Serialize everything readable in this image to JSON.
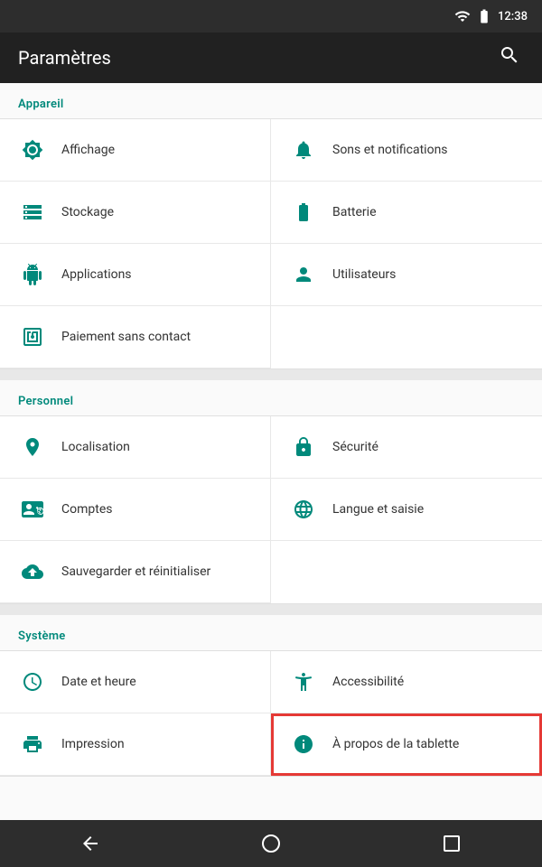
{
  "statusBar": {
    "time": "12:38"
  },
  "topBar": {
    "title": "Paramètres",
    "searchLabel": "Rechercher"
  },
  "sections": [
    {
      "id": "appareil",
      "header": "Appareil",
      "items": [
        {
          "id": "affichage",
          "label": "Affichage",
          "icon": "display",
          "fullWidth": false
        },
        {
          "id": "sons-notifications",
          "label": "Sons et notifications",
          "icon": "bell",
          "fullWidth": false
        },
        {
          "id": "stockage",
          "label": "Stockage",
          "icon": "storage",
          "fullWidth": false
        },
        {
          "id": "batterie",
          "label": "Batterie",
          "icon": "battery",
          "fullWidth": false
        },
        {
          "id": "applications",
          "label": "Applications",
          "icon": "android",
          "fullWidth": false
        },
        {
          "id": "utilisateurs",
          "label": "Utilisateurs",
          "icon": "person",
          "fullWidth": false
        },
        {
          "id": "paiement",
          "label": "Paiement sans contact",
          "icon": "nfc",
          "fullWidth": true
        }
      ]
    },
    {
      "id": "personnel",
      "header": "Personnel",
      "items": [
        {
          "id": "localisation",
          "label": "Localisation",
          "icon": "location",
          "fullWidth": false
        },
        {
          "id": "securite",
          "label": "Sécurité",
          "icon": "lock",
          "fullWidth": false
        },
        {
          "id": "comptes",
          "label": "Comptes",
          "icon": "contacts",
          "fullWidth": false
        },
        {
          "id": "langue",
          "label": "Langue et saisie",
          "icon": "globe",
          "fullWidth": false
        },
        {
          "id": "sauvegarder",
          "label": "Sauvegarder et réinitialiser",
          "icon": "backup",
          "fullWidth": true
        }
      ]
    },
    {
      "id": "systeme",
      "header": "Système",
      "items": [
        {
          "id": "date-heure",
          "label": "Date et heure",
          "icon": "clock",
          "fullWidth": false
        },
        {
          "id": "accessibilite",
          "label": "Accessibilité",
          "icon": "accessibility",
          "fullWidth": false
        },
        {
          "id": "impression",
          "label": "Impression",
          "icon": "print",
          "fullWidth": false,
          "highlighted": false
        },
        {
          "id": "a-propos",
          "label": "À propos de la tablette",
          "icon": "info",
          "fullWidth": false,
          "highlighted": true
        }
      ]
    }
  ],
  "bottomNav": {
    "back": "◁",
    "home": "○",
    "recent": "□"
  },
  "colors": {
    "teal": "#00897b",
    "darkBg": "#212121",
    "statusBg": "#2d2d2d",
    "sectionHeader": "#00897b",
    "highlight": "#e53935"
  }
}
